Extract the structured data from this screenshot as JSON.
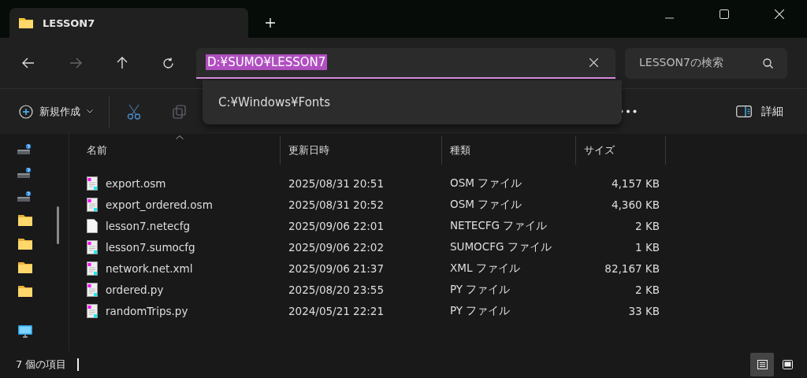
{
  "window": {
    "tabs": [
      {
        "title": "LESSON7",
        "selected": true
      }
    ]
  },
  "address_bar": {
    "value": "D:¥SUMO¥LESSON7",
    "text_selected": true,
    "suggestions": [
      "C:¥Windows¥Fonts"
    ]
  },
  "search": {
    "placeholder": "LESSON7の検索"
  },
  "toolbar": {
    "new_button": "新規作成",
    "details_button": "詳細"
  },
  "sidebar": {
    "items": [
      {
        "kind": "drive"
      },
      {
        "kind": "drive"
      },
      {
        "kind": "drive"
      },
      {
        "kind": "folder"
      },
      {
        "kind": "folder"
      },
      {
        "kind": "folder"
      },
      {
        "kind": "folder"
      },
      {
        "kind": "monitor"
      }
    ]
  },
  "table": {
    "columns": [
      {
        "label": "名前",
        "sorted": true
      },
      {
        "label": "更新日時",
        "sorted": false
      },
      {
        "label": "種類",
        "sorted": false
      },
      {
        "label": "サイズ",
        "sorted": false
      }
    ],
    "rows": [
      {
        "kind": "document",
        "name": "export.osm",
        "modified": "2025/08/31 20:51",
        "type": "OSM ファイル",
        "size": "4,157 KB"
      },
      {
        "kind": "document",
        "name": "export_ordered.osm",
        "modified": "2025/08/31 20:52",
        "type": "OSM ファイル",
        "size": "4,360 KB"
      },
      {
        "kind": "blank",
        "name": "lesson7.netecfg",
        "modified": "2025/09/06 22:01",
        "type": "NETECFG ファイル",
        "size": "2 KB"
      },
      {
        "kind": "document",
        "name": "lesson7.sumocfg",
        "modified": "2025/09/06 22:02",
        "type": "SUMOCFG ファイル",
        "size": "1 KB"
      },
      {
        "kind": "document",
        "name": "network.net.xml",
        "modified": "2025/09/06 21:37",
        "type": "XML ファイル",
        "size": "82,167 KB"
      },
      {
        "kind": "document",
        "name": "ordered.py",
        "modified": "2025/08/20 23:55",
        "type": "PY ファイル",
        "size": "2 KB"
      },
      {
        "kind": "document",
        "name": "randomTrips.py",
        "modified": "2024/05/21 22:21",
        "type": "PY ファイル",
        "size": "33 KB"
      }
    ]
  },
  "status_bar": {
    "item_count": "7 個の項目",
    "views": [
      {
        "kind": "details",
        "selected": true
      },
      {
        "kind": "tiles",
        "selected": false
      }
    ]
  }
}
